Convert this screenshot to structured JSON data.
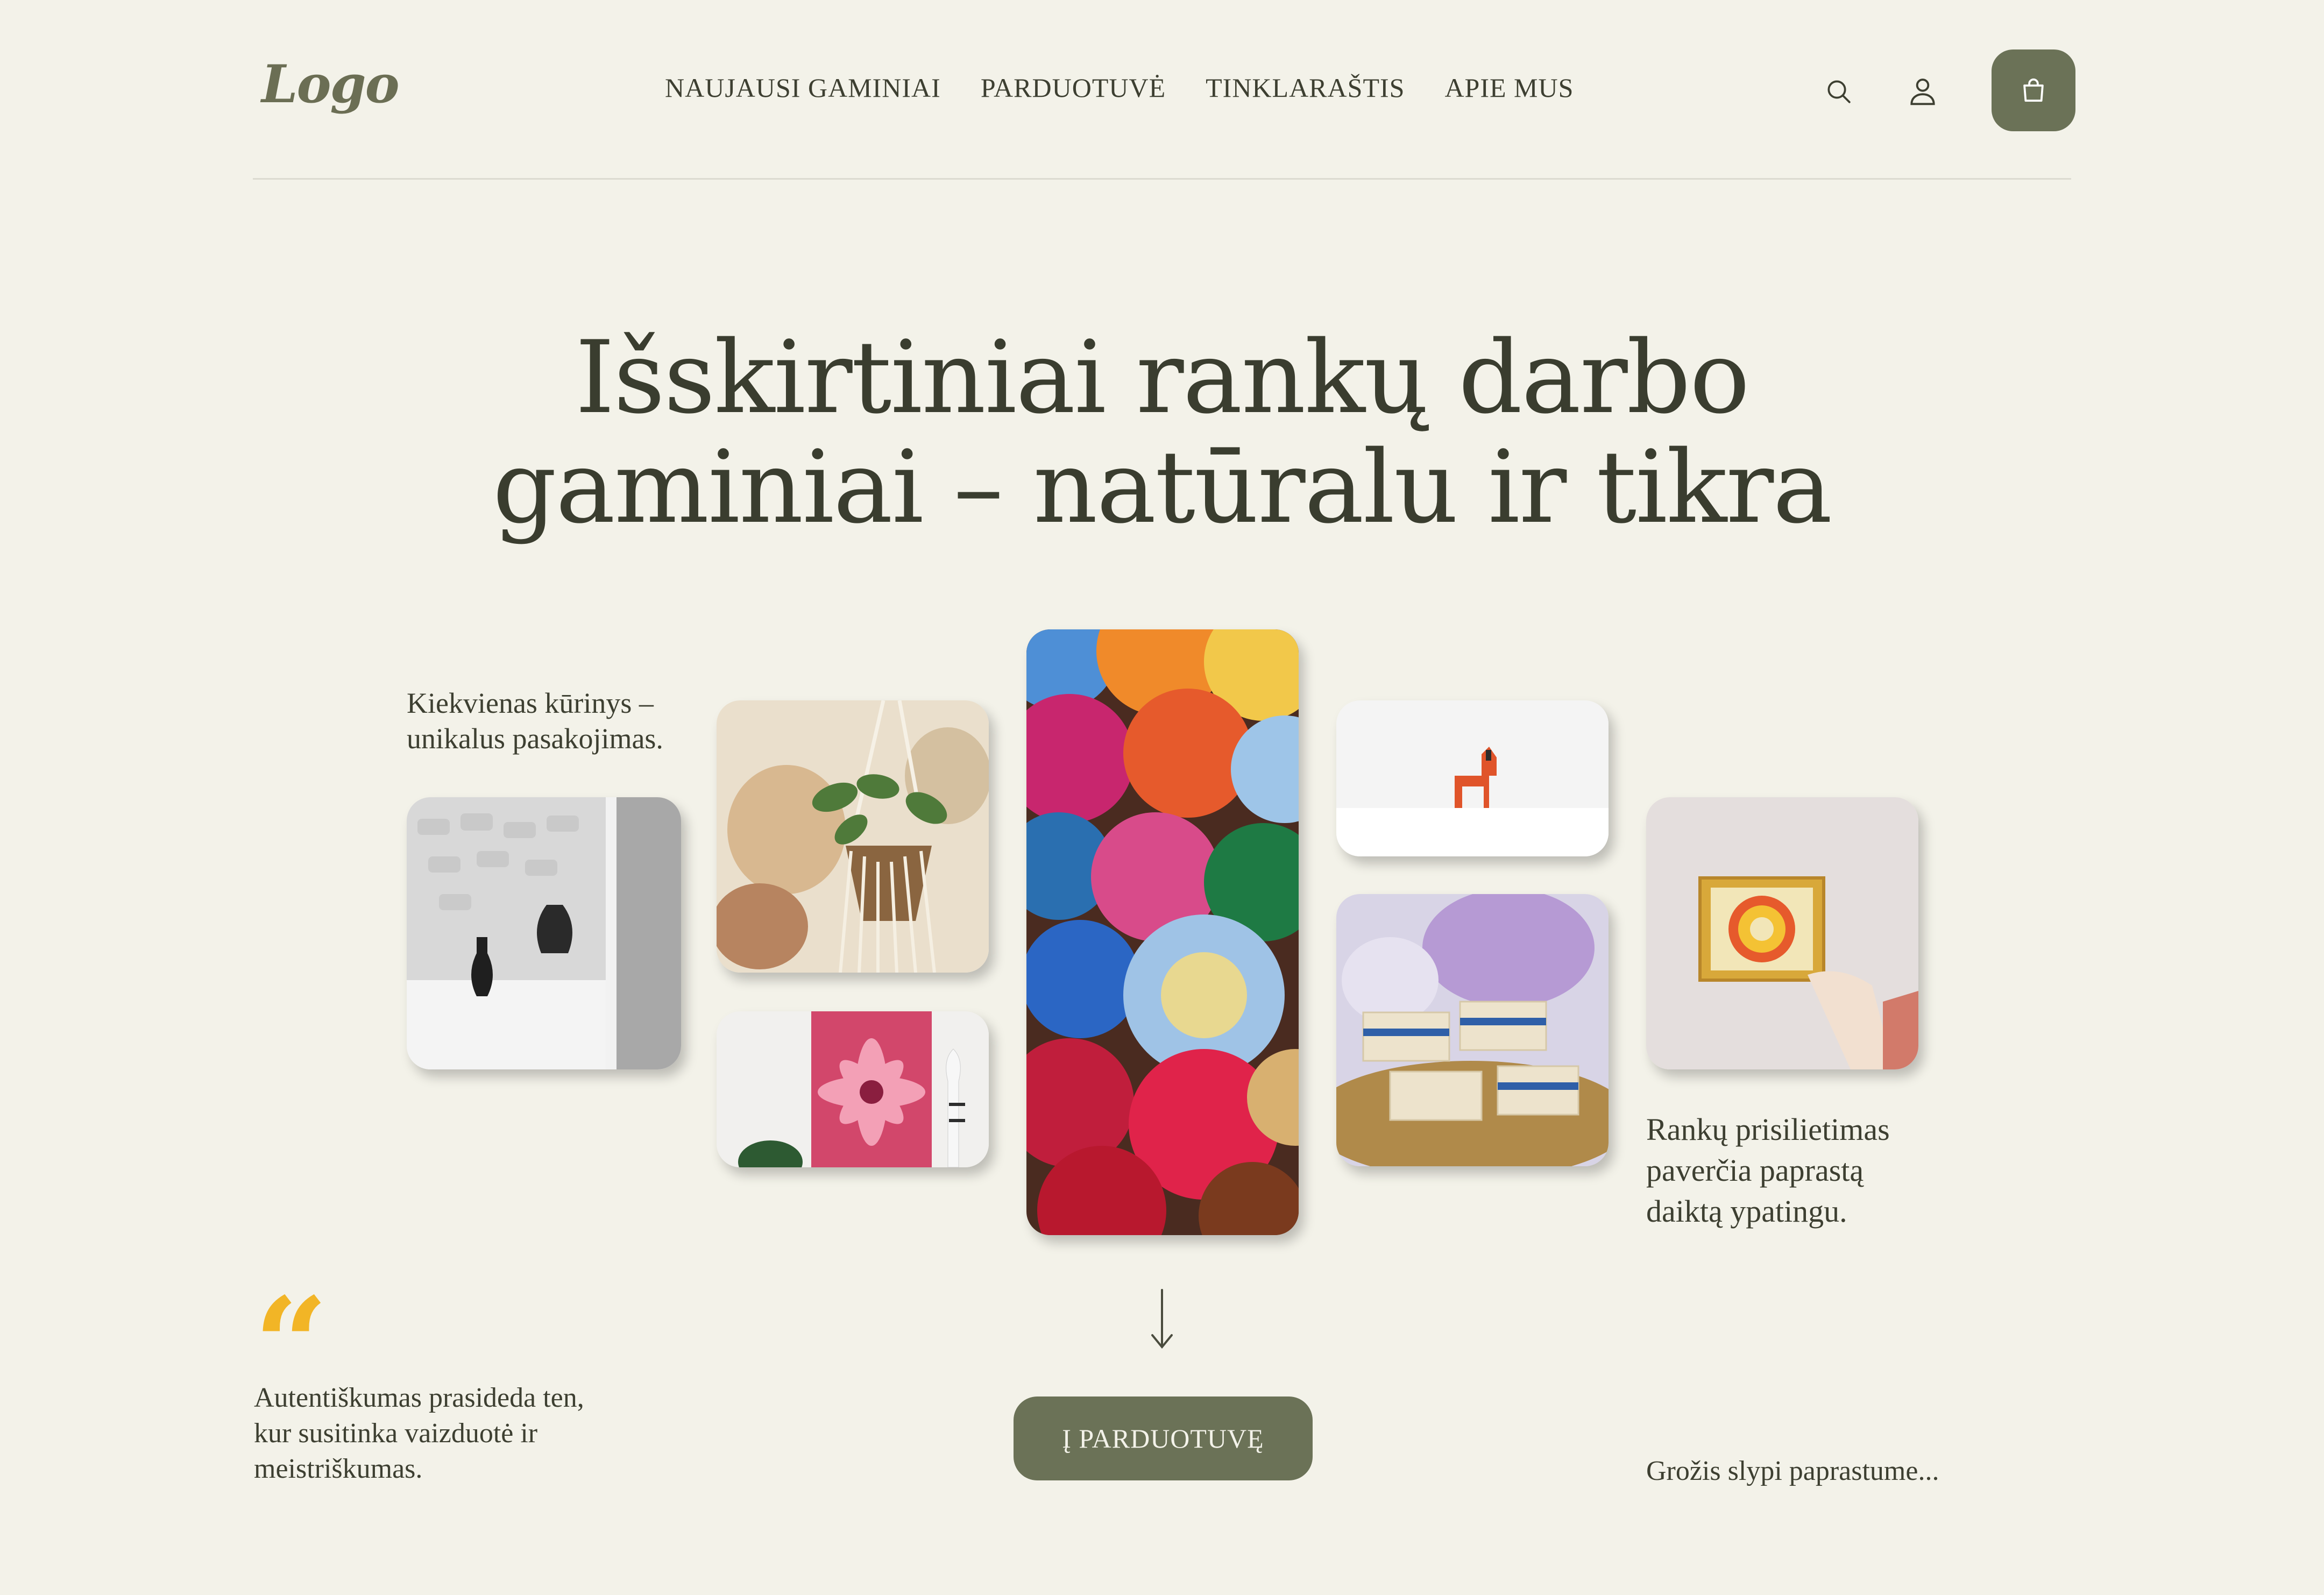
{
  "header": {
    "logo_text": "Logo",
    "nav": [
      "NAUJAUSI GAMINIAI",
      "PARDUOTUVĖ",
      "TINKLARAŠTIS",
      "APIE MUS"
    ]
  },
  "hero": {
    "title_line1": "Išskirtiniai rankų darbo",
    "title_line2": "gaminiai – natūralu ir tikra"
  },
  "captions": {
    "left_line1": "Kiekvienas kūrinys –",
    "left_line2": "unikalus pasakojimas.",
    "right_line1": "Rankų prisilietimas",
    "right_line2": "paverčia paprastą",
    "right_line3": "daiktą ypatingu."
  },
  "quote": {
    "mark": "“",
    "line1": "Autentiškumas prasideda ten,",
    "line2": "kur susitinka vaizduotė ir",
    "line3": "meistriškumas."
  },
  "cta": {
    "label": "Į PARDUOTUVĘ"
  },
  "tagline": "Grožis slypi paprastume...",
  "colors": {
    "background": "#f3f2e9",
    "accent": "#6b7257",
    "quote": "#f2b526",
    "text": "#3d3f31"
  },
  "icons": [
    "search-icon",
    "user-icon",
    "shopping-bag-icon",
    "arrow-down-icon"
  ]
}
